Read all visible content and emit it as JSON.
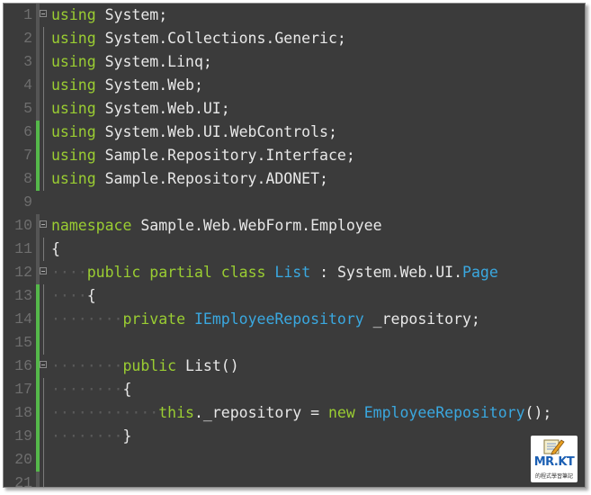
{
  "editor": {
    "colors": {
      "background": "#3b3b3b",
      "keyword": "#9acd32",
      "type": "#3aa8e0",
      "text": "#e8e8e8",
      "line_number": "#6e6e6e",
      "changed_bar": "#55b84a"
    },
    "lines": [
      {
        "n": "1",
        "bar": "dark",
        "fold": true,
        "guide": false,
        "indent": "",
        "tokens": [
          [
            "kw",
            "using"
          ],
          [
            "tx",
            " System;"
          ]
        ]
      },
      {
        "n": "2",
        "bar": "dark",
        "fold": false,
        "guide": true,
        "indent": "",
        "tokens": [
          [
            "kw",
            "using"
          ],
          [
            "tx",
            " System.Collections.Generic;"
          ]
        ]
      },
      {
        "n": "3",
        "bar": "dark",
        "fold": false,
        "guide": true,
        "indent": "",
        "tokens": [
          [
            "kw",
            "using"
          ],
          [
            "tx",
            " System.Linq;"
          ]
        ]
      },
      {
        "n": "4",
        "bar": "dark",
        "fold": false,
        "guide": true,
        "indent": "",
        "tokens": [
          [
            "kw",
            "using"
          ],
          [
            "tx",
            " System.Web;"
          ]
        ]
      },
      {
        "n": "5",
        "bar": "dark",
        "fold": false,
        "guide": true,
        "indent": "",
        "tokens": [
          [
            "kw",
            "using"
          ],
          [
            "tx",
            " System.Web.UI;"
          ]
        ]
      },
      {
        "n": "6",
        "bar": "green",
        "fold": false,
        "guide": true,
        "indent": "",
        "tokens": [
          [
            "kw",
            "using"
          ],
          [
            "tx",
            " System.Web.UI.WebControls;"
          ]
        ]
      },
      {
        "n": "7",
        "bar": "green",
        "fold": false,
        "guide": true,
        "indent": "",
        "tokens": [
          [
            "kw",
            "using"
          ],
          [
            "tx",
            " Sample.Repository.Interface;"
          ]
        ]
      },
      {
        "n": "8",
        "bar": "green",
        "fold": false,
        "guide": true,
        "indent": "",
        "tokens": [
          [
            "kw",
            "using"
          ],
          [
            "tx",
            " Sample.Repository.ADONET;"
          ]
        ]
      },
      {
        "n": "9",
        "bar": "none",
        "fold": false,
        "guide": false,
        "indent": "",
        "tokens": []
      },
      {
        "n": "10",
        "bar": "dark",
        "fold": true,
        "guide": false,
        "indent": "",
        "tokens": [
          [
            "kw",
            "namespace"
          ],
          [
            "tx",
            " Sample.Web.WebForm.Employee"
          ]
        ]
      },
      {
        "n": "11",
        "bar": "dark",
        "fold": false,
        "guide": true,
        "indent": "",
        "tokens": [
          [
            "tx",
            "{"
          ]
        ]
      },
      {
        "n": "12",
        "bar": "dark",
        "fold": true,
        "guide": false,
        "indent": "····",
        "tokens": [
          [
            "kw",
            "public"
          ],
          [
            "tx",
            " "
          ],
          [
            "kw",
            "partial"
          ],
          [
            "tx",
            " "
          ],
          [
            "kw",
            "class"
          ],
          [
            "tx",
            " "
          ],
          [
            "ty",
            "List"
          ],
          [
            "tx",
            " : System.Web.UI."
          ],
          [
            "ty",
            "Page"
          ]
        ]
      },
      {
        "n": "13",
        "bar": "green",
        "fold": false,
        "guide": true,
        "indent": "····",
        "tokens": [
          [
            "tx",
            "{"
          ]
        ]
      },
      {
        "n": "14",
        "bar": "green",
        "fold": false,
        "guide": true,
        "indent": "········",
        "tokens": [
          [
            "kw",
            "private"
          ],
          [
            "tx",
            " "
          ],
          [
            "ty",
            "IEmployeeRepository"
          ],
          [
            "tx",
            " _repository;"
          ]
        ]
      },
      {
        "n": "15",
        "bar": "green",
        "fold": false,
        "guide": true,
        "indent": "",
        "tokens": []
      },
      {
        "n": "16",
        "bar": "green",
        "fold": true,
        "guide": false,
        "indent": "········",
        "tokens": [
          [
            "kw",
            "public"
          ],
          [
            "tx",
            " List()"
          ]
        ]
      },
      {
        "n": "17",
        "bar": "green",
        "fold": false,
        "guide": true,
        "indent": "········",
        "tokens": [
          [
            "tx",
            "{"
          ]
        ]
      },
      {
        "n": "18",
        "bar": "green",
        "fold": false,
        "guide": true,
        "indent": "············",
        "tokens": [
          [
            "kw",
            "this"
          ],
          [
            "tx",
            "._repository = "
          ],
          [
            "kw",
            "new"
          ],
          [
            "tx",
            " "
          ],
          [
            "ty",
            "EmployeeRepository"
          ],
          [
            "tx",
            "();"
          ]
        ]
      },
      {
        "n": "19",
        "bar": "green",
        "fold": false,
        "guide": true,
        "indent": "········",
        "tokens": [
          [
            "tx",
            "}"
          ]
        ]
      },
      {
        "n": "20",
        "bar": "green",
        "fold": false,
        "guide": true,
        "indent": "",
        "tokens": []
      },
      {
        "n": "21",
        "bar": "dark",
        "fold": false,
        "guide": true,
        "indent": "",
        "tokens": []
      }
    ]
  },
  "watermark": {
    "main": "MR.KT",
    "sub": "的程式學習筆記",
    "icon": "notepad-pencil-icon"
  }
}
